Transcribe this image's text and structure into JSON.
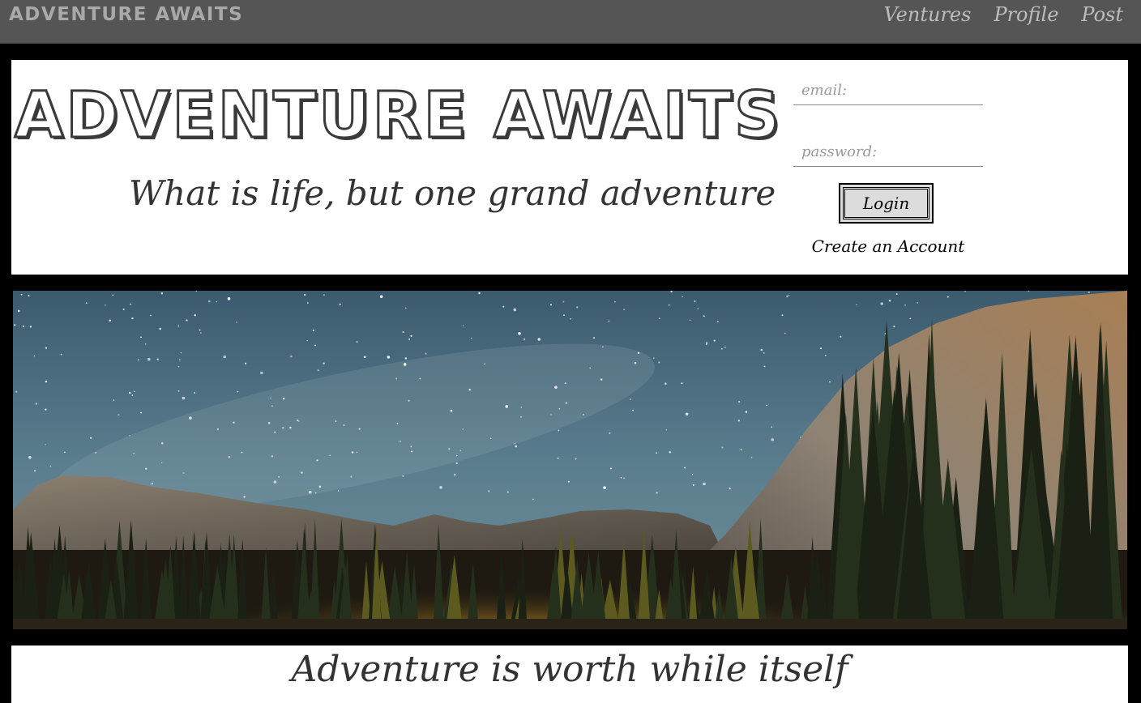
{
  "nav": {
    "brand": "ADVENTURE AWAITS",
    "links": [
      "Ventures",
      "Profile",
      "Post"
    ]
  },
  "header": {
    "title": "ADVENTURE AWAITS",
    "tagline": "What is life, but one grand adventure"
  },
  "login": {
    "email_placeholder": "email:",
    "password_placeholder": "password:",
    "button_label": "Login",
    "create_account": "Create an Account"
  },
  "footer": {
    "quote": "Adventure is worth while itself"
  },
  "colors": {
    "nav_bg": "#555555",
    "page_bg": "#000000",
    "panel_bg": "#ffffff"
  }
}
